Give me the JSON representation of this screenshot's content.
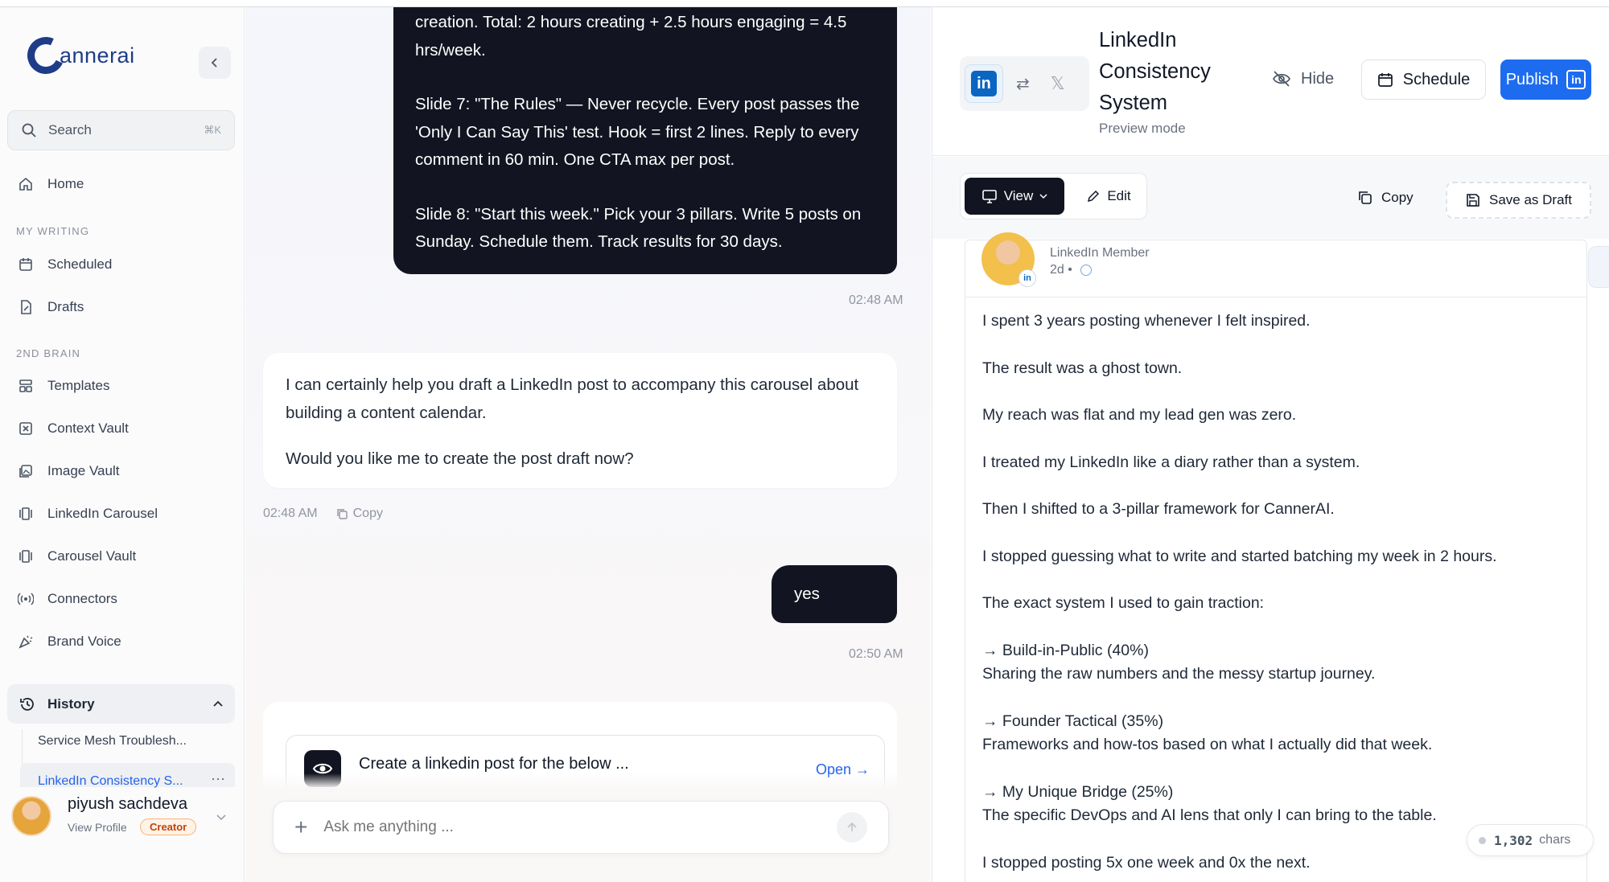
{
  "sidebar": {
    "logo_text": "annerai",
    "search": {
      "label": "Search",
      "shortcut": "⌘K"
    },
    "home": "Home",
    "section_writing": "MY WRITING",
    "scheduled": "Scheduled",
    "drafts": "Drafts",
    "section_brain": "2ND BRAIN",
    "templates": "Templates",
    "context_vault": "Context Vault",
    "image_vault": "Image Vault",
    "linkedin_carousel": "LinkedIn Carousel",
    "carousel_vault": "Carousel Vault",
    "connectors": "Connectors",
    "brand_voice": "Brand Voice",
    "history_label": "History",
    "history_items": [
      "Service Mesh Troublesh...",
      "LinkedIn Consistency S..."
    ],
    "user": {
      "name": "piyush sachdeva",
      "view_profile": "View Profile",
      "badge": "Creator"
    }
  },
  "chat": {
    "ai_message_top": [
      "creation. Total: 2 hours creating + 2.5 hours engaging = 4.5 hrs/week.",
      "Slide 7: \"The Rules\" — Never recycle. Every post passes the 'Only I Can Say This' test. Hook = first 2 lines. Reply to every comment in 60 min. One CTA max per post.",
      "Slide 8: \"Start this week.\" Pick your 3 pillars. Write 5 posts on Sunday. Schedule them. Track results for 30 days."
    ],
    "time_1": "02:48 AM",
    "assistant_reply": [
      "I can certainly help you draft a LinkedIn post to accompany this carousel about building a content calendar.",
      "Would you like me to create the post draft now?"
    ],
    "time_2": "02:48 AM",
    "copy_label": "Copy",
    "user_reply": "yes",
    "time_3": "02:50 AM",
    "card_title": "Create a linkedin post for the below ...",
    "card_open": "Open →",
    "input_placeholder": "Ask me anything ..."
  },
  "preview": {
    "title": "LinkedIn Consistency System",
    "mode": "Preview mode",
    "hide": "Hide",
    "schedule": "Schedule",
    "publish": "Publish",
    "view": "View",
    "edit": "Edit",
    "copy": "Copy",
    "save_draft": "Save as Draft",
    "post": {
      "author_sub": "LinkedIn Member",
      "time": "2d •",
      "lines": [
        "I spent 3 years posting whenever I felt inspired.",
        "",
        "The result was a ghost town.",
        "",
        "My reach was flat and my lead gen was zero.",
        "",
        "I treated my LinkedIn like a diary rather than a system.",
        "",
        "Then I shifted to a 3-pillar framework for CannerAI.",
        "",
        "I stopped guessing what to write and started batching my week in 2 hours.",
        "",
        "The exact system I used to gain traction:",
        "",
        "→ Build-in-Public (40%)",
        "Sharing the raw numbers and the messy startup journey.",
        "",
        "→ Founder Tactical (35%)",
        "Frameworks and how-tos based on what I actually did that week.",
        "",
        "→ My Unique Bridge (25%)",
        "The specific DevOps and AI lens that only I can bring to the table.",
        "",
        "I stopped posting 5x one week and 0x the next."
      ]
    },
    "chars_count": "1,302",
    "chars_label": "chars"
  }
}
